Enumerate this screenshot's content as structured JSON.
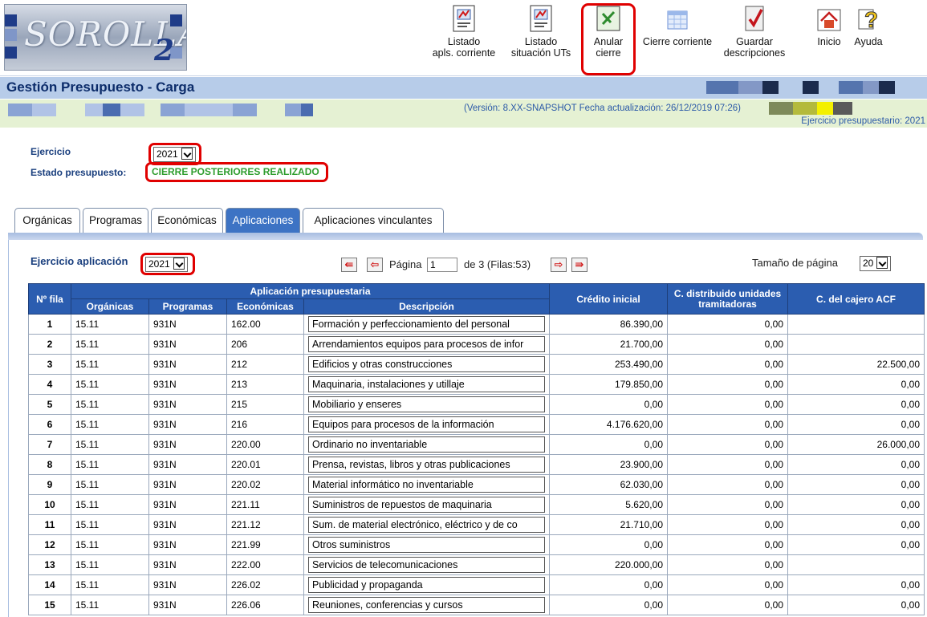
{
  "app": {
    "logo_text": "SOROLLA",
    "logo_version": "2",
    "colors": {
      "header_bar": "#b7cce9",
      "version_bar": "#e5f1d3",
      "table_header": "#2b5db0",
      "active_tab": "#3d73c4",
      "highlight": "#e00000",
      "status_green": "#2e9d2e"
    }
  },
  "toolbar": {
    "items": [
      {
        "label1": "Listado",
        "label2": "apls. corriente",
        "icon": "report-icon"
      },
      {
        "label1": "Listado",
        "label2": "situación UTs",
        "icon": "report-icon"
      },
      {
        "label1": "Anular",
        "label2": "cierre",
        "icon": "cancel-x-icon"
      },
      {
        "label1": "",
        "label2": "Cierre corriente",
        "icon": "calendar-icon"
      },
      {
        "label1": "Guardar",
        "label2": "descripciones",
        "icon": "save-check-icon"
      },
      {
        "label1": "",
        "label2": "Inicio",
        "icon": "home-icon"
      },
      {
        "label1": "",
        "label2": "Ayuda",
        "icon": "help-icon"
      }
    ]
  },
  "page": {
    "title": "Gestión Presupuesto - Carga",
    "version": "(Versión: 8.XX-SNAPSHOT Fecha actualización: 26/12/2019 07:26)",
    "ejercicio_presupuestario": "Ejercicio presupuestario: 2021"
  },
  "filters": {
    "ejercicio_label": "Ejercicio",
    "ejercicio_value": "2021",
    "estado_label": "Estado presupuesto:",
    "estado_value": "CIERRE POSTERIORES REALIZADO"
  },
  "tabs": [
    {
      "label": "Orgánicas",
      "active": false
    },
    {
      "label": "Programas",
      "active": false
    },
    {
      "label": "Económicas",
      "active": false
    },
    {
      "label": "Aplicaciones",
      "active": true
    },
    {
      "label": "Aplicaciones vinculantes",
      "active": false
    }
  ],
  "pager": {
    "ejercicio_aplicacion_label": "Ejercicio aplicación",
    "ejercicio_aplicacion_value": "2021",
    "pagina_label": "Página",
    "pagina_value": "1",
    "of_text": "de 3 (Filas:53)",
    "page_size_label": "Tamaño de página",
    "page_size_value": "20"
  },
  "table": {
    "headers": {
      "nfila": "Nº fila",
      "aplicacion": "Aplicación presupuestaria",
      "organicas": "Orgánicas",
      "programas": "Programas",
      "economicas": "Económicas",
      "descripcion": "Descripción",
      "credito": "Crédito inicial",
      "distribuido": "C. distribuido unidades tramitadoras",
      "cajero": "C. del cajero ACF"
    },
    "rows": [
      [
        "1",
        "15.11",
        "931N",
        "162.00",
        "Formación y perfeccionamiento del personal",
        "86.390,00",
        "0,00",
        ""
      ],
      [
        "2",
        "15.11",
        "931N",
        "206",
        "Arrendamientos equipos para procesos de infor",
        "21.700,00",
        "0,00",
        ""
      ],
      [
        "3",
        "15.11",
        "931N",
        "212",
        "Edificios y otras construcciones",
        "253.490,00",
        "0,00",
        "22.500,00"
      ],
      [
        "4",
        "15.11",
        "931N",
        "213",
        "Maquinaria, instalaciones y utillaje",
        "179.850,00",
        "0,00",
        "0,00"
      ],
      [
        "5",
        "15.11",
        "931N",
        "215",
        "Mobiliario y enseres",
        "0,00",
        "0,00",
        "0,00"
      ],
      [
        "6",
        "15.11",
        "931N",
        "216",
        "Equipos para procesos de la información",
        "4.176.620,00",
        "0,00",
        "0,00"
      ],
      [
        "7",
        "15.11",
        "931N",
        "220.00",
        "Ordinario no inventariable",
        "0,00",
        "0,00",
        "26.000,00"
      ],
      [
        "8",
        "15.11",
        "931N",
        "220.01",
        "Prensa, revistas, libros y otras publicaciones",
        "23.900,00",
        "0,00",
        "0,00"
      ],
      [
        "9",
        "15.11",
        "931N",
        "220.02",
        "Material informático no inventariable",
        "62.030,00",
        "0,00",
        "0,00"
      ],
      [
        "10",
        "15.11",
        "931N",
        "221.11",
        "Suministros de repuestos de maquinaria",
        "5.620,00",
        "0,00",
        "0,00"
      ],
      [
        "11",
        "15.11",
        "931N",
        "221.12",
        "Sum. de material electrónico, eléctrico y de co",
        "21.710,00",
        "0,00",
        "0,00"
      ],
      [
        "12",
        "15.11",
        "931N",
        "221.99",
        "Otros suministros",
        "0,00",
        "0,00",
        "0,00"
      ],
      [
        "13",
        "15.11",
        "931N",
        "222.00",
        "Servicios de telecomunicaciones",
        "220.000,00",
        "0,00",
        ""
      ],
      [
        "14",
        "15.11",
        "931N",
        "226.02",
        "Publicidad y propaganda",
        "0,00",
        "0,00",
        "0,00"
      ],
      [
        "15",
        "15.11",
        "931N",
        "226.06",
        "Reuniones, conferencias y cursos",
        "0,00",
        "0,00",
        "0,00"
      ]
    ]
  }
}
